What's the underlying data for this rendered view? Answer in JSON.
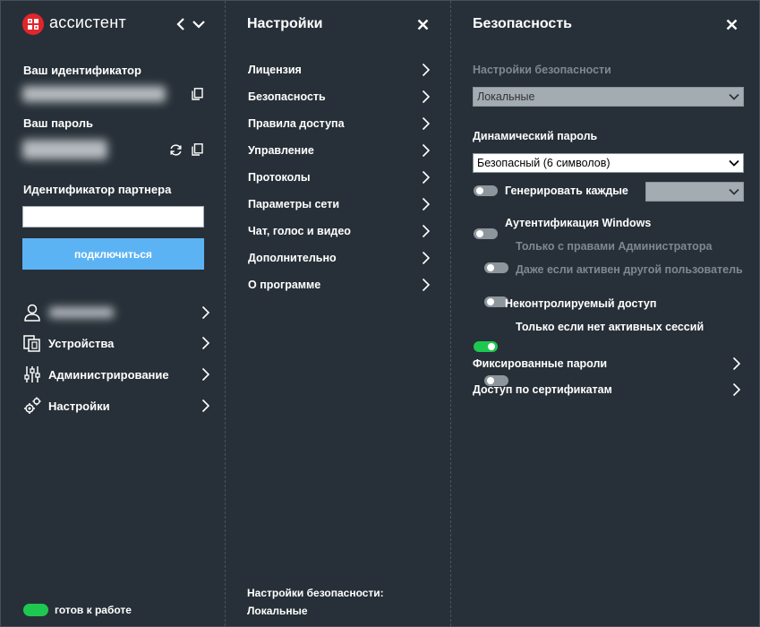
{
  "app": {
    "name": "ассистент"
  },
  "left": {
    "id_label": "Ваш идентификатор",
    "id_value": "",
    "password_label": "Ваш пароль",
    "password_value": "",
    "partner_label": "Идентификатор партнера",
    "partner_value": "",
    "connect_label": "подключиться",
    "nav": [
      {
        "label": "",
        "icon": "user-icon"
      },
      {
        "label": "Устройства",
        "icon": "devices-icon"
      },
      {
        "label": "Администрирование",
        "icon": "sliders-icon"
      },
      {
        "label": "Настройки",
        "icon": "gears-icon"
      }
    ],
    "status": "готов к работе",
    "status_color": "#1ec850"
  },
  "settings": {
    "title": "Настройки",
    "items": [
      "Лицензия",
      "Безопасность",
      "Правила доступа",
      "Управление",
      "Протоколы",
      "Параметры сети",
      "Чат, голос и видео",
      "Дополнительно",
      "О программе"
    ],
    "footer_label": "Настройки безопасности:",
    "footer_value": "Локальные"
  },
  "security": {
    "title": "Безопасность",
    "settings_label": "Настройки безопасности",
    "settings_value": "Локальные",
    "dynamic_label": "Динамический пароль",
    "dynamic_value": "Безопасный (6 символов)",
    "generate_label": "Генерировать каждые",
    "generate_value": "",
    "generate_on": false,
    "windows_auth_label": "Аутентификация Windows",
    "windows_auth_on": false,
    "admin_only_label": "Только с правами Администратора",
    "admin_only_on": false,
    "other_user_label": "Даже если активен другой пользователь",
    "other_user_on": false,
    "uncontrolled_label": "Неконтролируемый доступ",
    "uncontrolled_on": true,
    "no_sessions_label": "Только если нет активных сессий",
    "no_sessions_on": false,
    "fixed_passwords_label": "Фиксированные пароли",
    "cert_access_label": "Доступ по сертификатам"
  },
  "colors": {
    "background": "#273038",
    "accent_button": "#5cb3f3",
    "toggle_on": "#1ec850",
    "toggle_off": "#8e969d",
    "logo_red": "#e0262c"
  }
}
